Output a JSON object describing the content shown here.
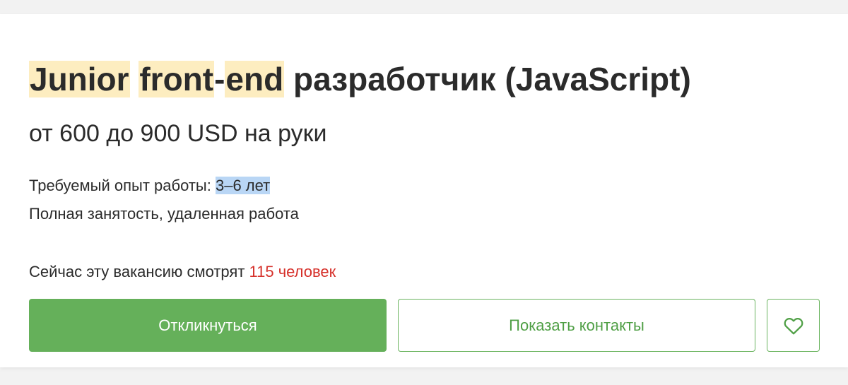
{
  "vacancy": {
    "title_parts": [
      "Junior",
      "front",
      "-",
      "end",
      "разработчик (JavaScript)"
    ],
    "salary": "от 600 до 900 USD на руки",
    "experience_label": "Требуемый опыт работы: ",
    "experience_value": "3–6 лет",
    "employment": "Полная занятость, удаленная работа",
    "viewers_text": "Сейчас эту вакансию смотрят ",
    "viewers_count": "115 человек"
  },
  "actions": {
    "apply_label": "Откликнуться",
    "contacts_label": "Показать контакты",
    "favorite_icon": "heart-icon"
  },
  "colors": {
    "primary_green": "#65b05a",
    "outline_green": "#6ab45f",
    "search_highlight": "#fdedc0",
    "selection_highlight": "#b9d6f5",
    "viewers_red": "#d6312b"
  }
}
